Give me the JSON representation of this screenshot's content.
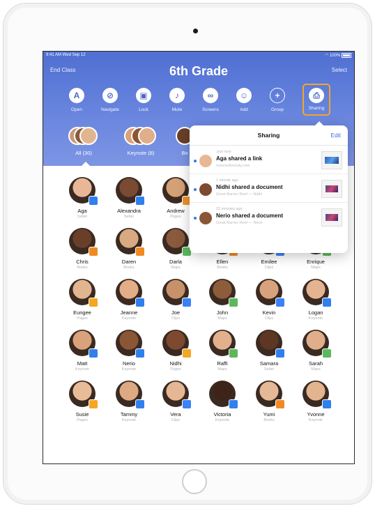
{
  "status_bar": {
    "time_date": "9:41 AM  Wed Sep 12",
    "battery": "100%"
  },
  "header": {
    "left_button": "End Class",
    "title": "6th Grade",
    "right_button": "Select"
  },
  "toolbar": [
    {
      "label": "Open",
      "icon": "app-store-icon"
    },
    {
      "label": "Navigate",
      "icon": "compass-icon"
    },
    {
      "label": "Lock",
      "icon": "lock-icon"
    },
    {
      "label": "Mute",
      "icon": "mute-icon"
    },
    {
      "label": "Screens",
      "icon": "binoculars-icon"
    },
    {
      "label": "Add",
      "icon": "add-person-icon"
    },
    {
      "label": "Group",
      "icon": "plus-icon"
    },
    {
      "label": "Sharing",
      "icon": "share-icon",
      "highlighted": true
    }
  ],
  "groups": [
    {
      "label": "All (30)"
    },
    {
      "label": "Keynote (8)"
    },
    {
      "label": "Bo"
    }
  ],
  "popover": {
    "title": "Sharing",
    "edit": "Edit",
    "items": [
      {
        "time": "Just now",
        "text": "Aga shared a link",
        "subtitle": "marinediversity.com"
      },
      {
        "time": "1 minute ago",
        "text": "Nidhi shared a document",
        "subtitle": "Great Barrier Reef — Nidhi"
      },
      {
        "time": "22 minutes ago",
        "text": "Nerio shared a document",
        "subtitle": "Great Barrier Reef — Nerio"
      }
    ]
  },
  "students": [
    {
      "name": "Aga",
      "app": "Safari",
      "badge_color": "#2f80ed",
      "face": "#e8b796"
    },
    {
      "name": "Alexandra",
      "app": "Safari",
      "badge_color": "#2f80ed",
      "face": "#7a4a32"
    },
    {
      "name": "Andrew",
      "app": "Pages",
      "badge_color": "#f0932b",
      "face": "#d4a076"
    },
    {
      "name": "Chris",
      "app": "Books",
      "badge_color": "#f08a24",
      "face": "#6a3f2a"
    },
    {
      "name": "Daren",
      "app": "Books",
      "badge_color": "#f08a24",
      "face": "#d9a981"
    },
    {
      "name": "Darla",
      "app": "Maps",
      "badge_color": "#5cb85c",
      "face": "#8a5a3c"
    },
    {
      "name": "Ellen",
      "app": "Books",
      "badge_color": "#f08a24",
      "face": "#e6b38e"
    },
    {
      "name": "Emilee",
      "app": "Clips",
      "badge_color": "#3b82f6",
      "face": "#5a3422"
    },
    {
      "name": "Enrique",
      "app": "Maps",
      "badge_color": "#5cb85c",
      "face": "#7b4b2f"
    },
    {
      "name": "Eungee",
      "app": "Pages",
      "badge_color": "#f5a623",
      "face": "#e2b591"
    },
    {
      "name": "Jeanne",
      "app": "Keynote",
      "badge_color": "#2f80ed",
      "face": "#e3ad88"
    },
    {
      "name": "Joe",
      "app": "Clips",
      "badge_color": "#3b82f6",
      "face": "#c7916b"
    },
    {
      "name": "John",
      "app": "Maps",
      "badge_color": "#5cb85c",
      "face": "#8d5d3b"
    },
    {
      "name": "Kevin",
      "app": "Clips",
      "badge_color": "#3b82f6",
      "face": "#d8a37c"
    },
    {
      "name": "Logan",
      "app": "Keynote",
      "badge_color": "#2f80ed",
      "face": "#e4b490"
    },
    {
      "name": "Matt",
      "app": "Keynote",
      "badge_color": "#2f80ed",
      "face": "#d9a27b"
    },
    {
      "name": "Nerio",
      "app": "Keynote",
      "badge_color": "#2f80ed",
      "face": "#8b5636"
    },
    {
      "name": "Nidhi",
      "app": "Pages",
      "badge_color": "#f5a623",
      "face": "#7d4a30"
    },
    {
      "name": "Raffi",
      "app": "Maps",
      "badge_color": "#5cb85c",
      "face": "#e1b08c"
    },
    {
      "name": "Samara",
      "app": "Safari",
      "badge_color": "#2f80ed",
      "face": "#5e3624"
    },
    {
      "name": "Sarah",
      "app": "Maps",
      "badge_color": "#5cb85c",
      "face": "#e0ae8a"
    },
    {
      "name": "Susie",
      "app": "Pages",
      "badge_color": "#f5a623",
      "face": "#e9bc98"
    },
    {
      "name": "Tammy",
      "app": "Keynote",
      "badge_color": "#2f80ed",
      "face": "#dca983"
    },
    {
      "name": "Vera",
      "app": "Clips",
      "badge_color": "#3b82f6",
      "face": "#e6b794"
    },
    {
      "name": "Victoria",
      "app": "Keynote",
      "badge_color": "#2f80ed",
      "face": "#3e2418"
    },
    {
      "name": "Yumi",
      "app": "Books",
      "badge_color": "#f08a24",
      "face": "#e5b998"
    },
    {
      "name": "Yvonne",
      "app": "Keynote",
      "badge_color": "#2f80ed",
      "face": "#e2b48f"
    }
  ]
}
